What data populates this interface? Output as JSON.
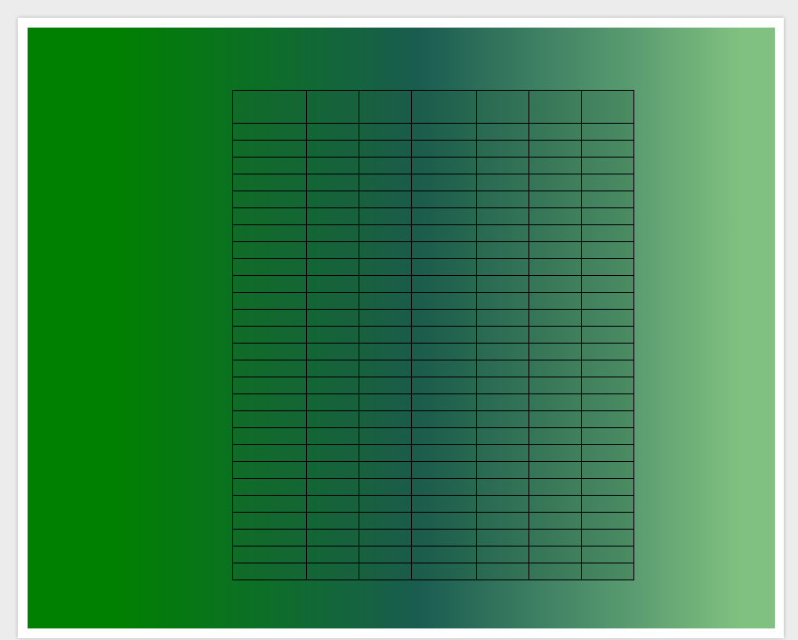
{
  "table": {
    "columns": 7,
    "rows": 28,
    "header_rows": 1,
    "cells_text": ""
  },
  "colors": {
    "gradient_left": "#008000",
    "gradient_mid": "#1a5c50",
    "gradient_right": "#80c080",
    "grid_line": "#000000",
    "frame": "#ffffff"
  }
}
